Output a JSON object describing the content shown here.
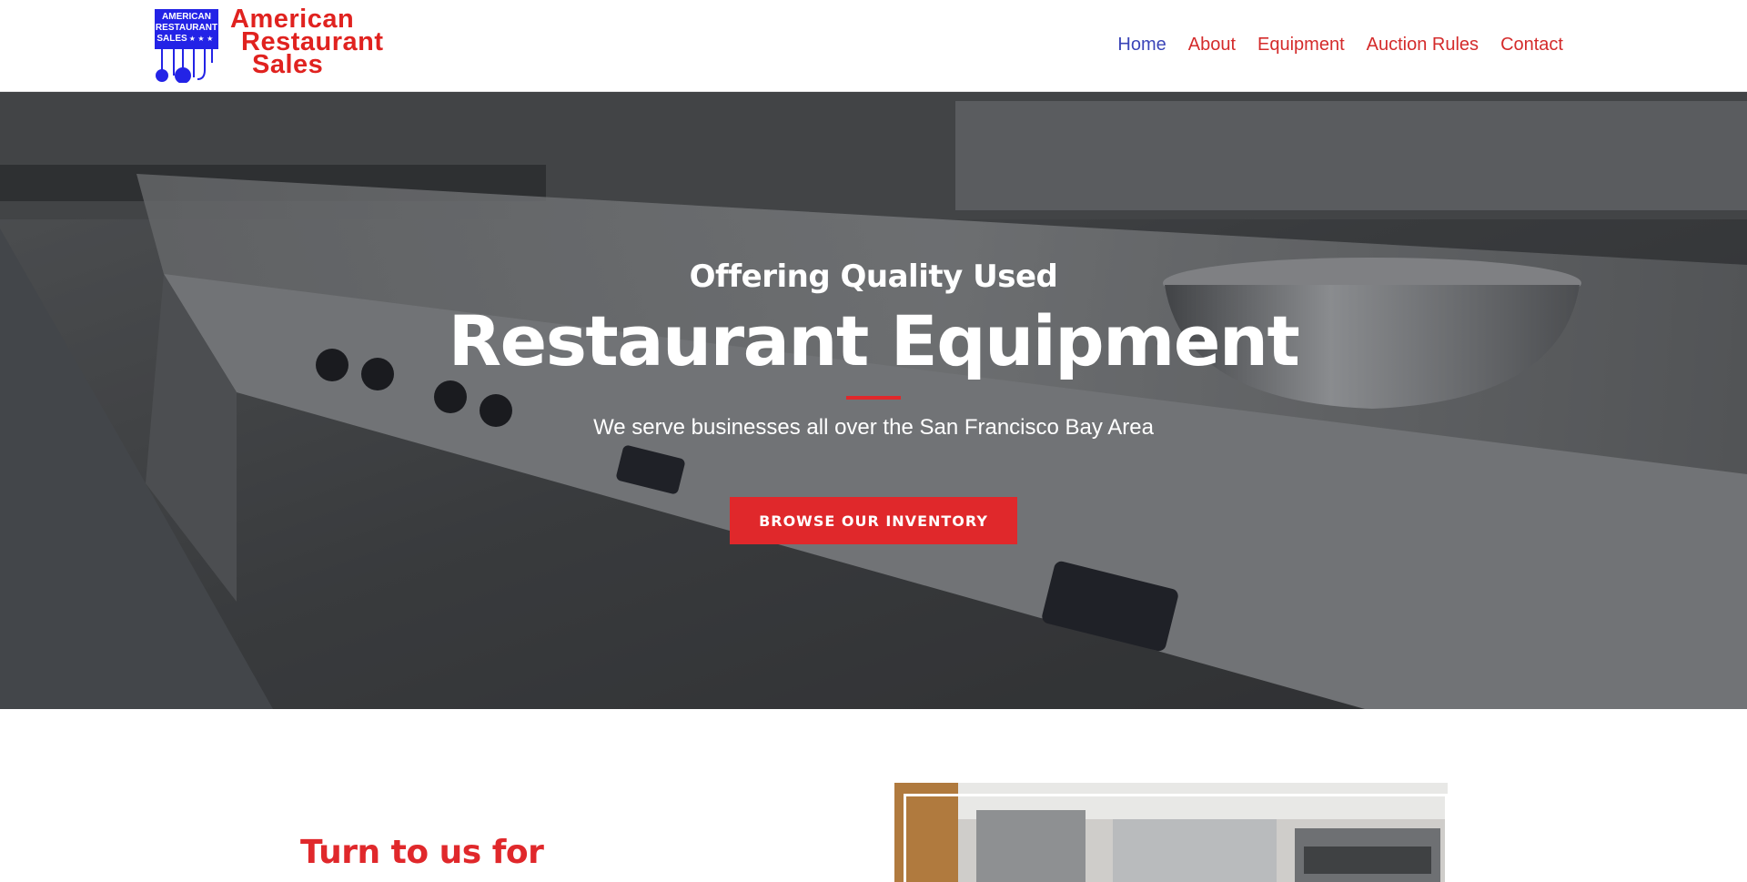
{
  "brand": {
    "logo_lines": [
      "American",
      "Restaurant",
      "Sales"
    ],
    "badge_lines": [
      "AMERICAN",
      "RESTAURANT",
      "SALES"
    ],
    "badge_stars": "★ ★ ★",
    "brand_red": "#e0221f",
    "brand_blue": "#2323e6"
  },
  "nav": {
    "items": [
      {
        "label": "Home",
        "active": true
      },
      {
        "label": "About",
        "active": false
      },
      {
        "label": "Equipment",
        "active": false
      },
      {
        "label": "Auction Rules",
        "active": false
      },
      {
        "label": "Contact",
        "active": false
      }
    ],
    "active_color": "#3b45b8",
    "link_color": "#d42b2b"
  },
  "hero": {
    "subtitle": "Offering Quality Used",
    "title": "Restaurant Equipment",
    "description": "We serve businesses all over the San Francisco Bay Area",
    "button_label": "BROWSE OUR INVENTORY",
    "accent": "#e0282b"
  },
  "section": {
    "heading": "Turn to us for"
  }
}
